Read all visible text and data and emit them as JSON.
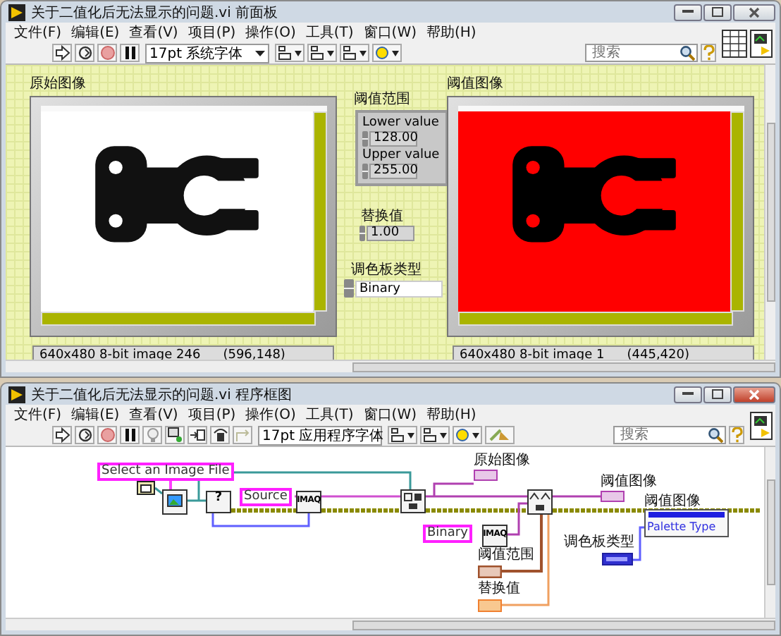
{
  "front_panel_window": {
    "title": "关于二值化后无法显示的问题.vi 前面板",
    "active": false,
    "menu": [
      "文件(F)",
      "编辑(E)",
      "查看(V)",
      "项目(P)",
      "操作(O)",
      "工具(T)",
      "窗口(W)",
      "帮助(H)"
    ],
    "font_menu": "17pt 系统字体",
    "search": {
      "placeholder": "搜索"
    },
    "original_image": {
      "label": "原始图像",
      "status": "640x480 8-bit image 246",
      "coords": "(596,148)"
    },
    "threshold_range": {
      "label": "阈值范围",
      "lower_label": "Lower value",
      "lower": "128.00",
      "upper_label": "Upper value",
      "upper": "255.00"
    },
    "replace_value": {
      "label": "替换值",
      "value": "1.00"
    },
    "palette_type": {
      "label": "调色板类型",
      "value": "Binary"
    },
    "threshold_image": {
      "label": "阈值图像",
      "status": "640x480 8-bit image 1",
      "coords": "(445,420)"
    }
  },
  "block_diagram_window": {
    "title": "关于二值化后无法显示的问题.vi 程序框图",
    "active": true,
    "menu": [
      "文件(F)",
      "编辑(E)",
      "查看(V)",
      "项目(P)",
      "操作(O)",
      "工具(T)",
      "窗口(W)",
      "帮助(H)"
    ],
    "font_menu": "17pt 应用程序字体",
    "search": {
      "placeholder": "搜索"
    },
    "diagram": {
      "path_constant": "Select an Image File",
      "query_node": "?",
      "source_constant": "Source",
      "imaq_nodes": [
        "IMAQ",
        "IMAQ"
      ],
      "binary_constant": "Binary",
      "original_image_terminal": "原始图像",
      "threshold_image_terminal": "阈值图像",
      "threshold_range_terminal": "阈值范围",
      "replace_value_terminal": "替换值",
      "property_node": {
        "label": "阈值图像",
        "property": "Palette Type"
      },
      "palette_type_terminal": "调色板类型"
    }
  }
}
